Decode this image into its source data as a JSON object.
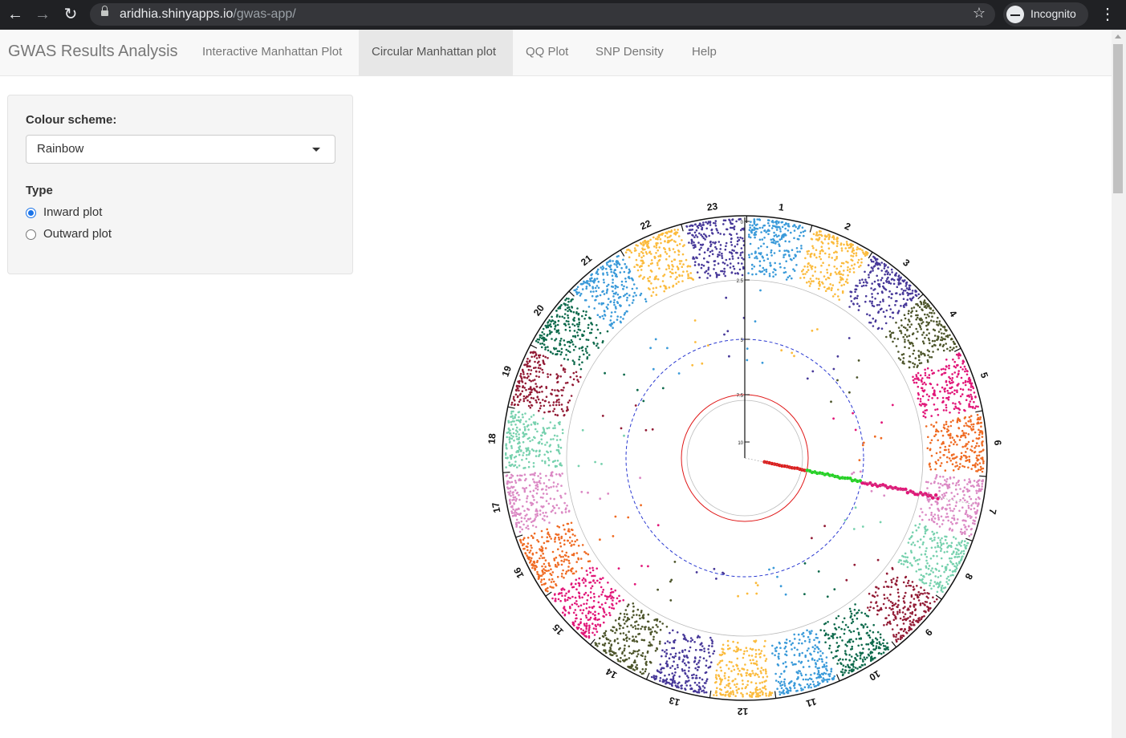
{
  "browser": {
    "url_host": "aridhia.shinyapps.io",
    "url_path": "/gwas-app/",
    "incognito_label": "Incognito"
  },
  "navbar": {
    "brand": "GWAS Results Analysis",
    "tabs": [
      {
        "label": "Interactive Manhattan Plot",
        "active": false
      },
      {
        "label": "Circular Manhattan plot",
        "active": true
      },
      {
        "label": "QQ Plot",
        "active": false
      },
      {
        "label": "SNP Density",
        "active": false
      },
      {
        "label": "Help",
        "active": false
      }
    ]
  },
  "sidebar": {
    "colour_scheme_label": "Colour scheme:",
    "colour_scheme_value": "Rainbow",
    "type_label": "Type",
    "type_options": [
      {
        "label": "Inward plot",
        "selected": true
      },
      {
        "label": "Outward plot",
        "selected": false
      }
    ]
  },
  "plot": {
    "chromosomes": [
      "1",
      "2",
      "3",
      "4",
      "5",
      "6",
      "7",
      "8",
      "9",
      "10",
      "11",
      "12",
      "13",
      "14",
      "15",
      "16",
      "17",
      "18",
      "19",
      "20",
      "21",
      "22",
      "23"
    ],
    "colors": [
      "#3a9ad9",
      "#fbbb3d",
      "#473899",
      "#4d552b",
      "#e11678",
      "#ef6b23",
      "#db89c4",
      "#77d1ae",
      "#921b35",
      "#0e6a4c",
      "#3a9ad9",
      "#fbbb3d",
      "#473899",
      "#4d552b",
      "#e11678",
      "#ef6b23",
      "#db89c4",
      "#77d1ae",
      "#921b35",
      "#0e6a4c",
      "#3a9ad9",
      "#fbbb3d",
      "#473899"
    ],
    "axis_ticks": [
      "0",
      "2.5",
      "5",
      "7.5",
      "10"
    ],
    "threshold_colors": {
      "suggestive": "#2a39d1",
      "genomewide": "#e01818"
    }
  }
}
